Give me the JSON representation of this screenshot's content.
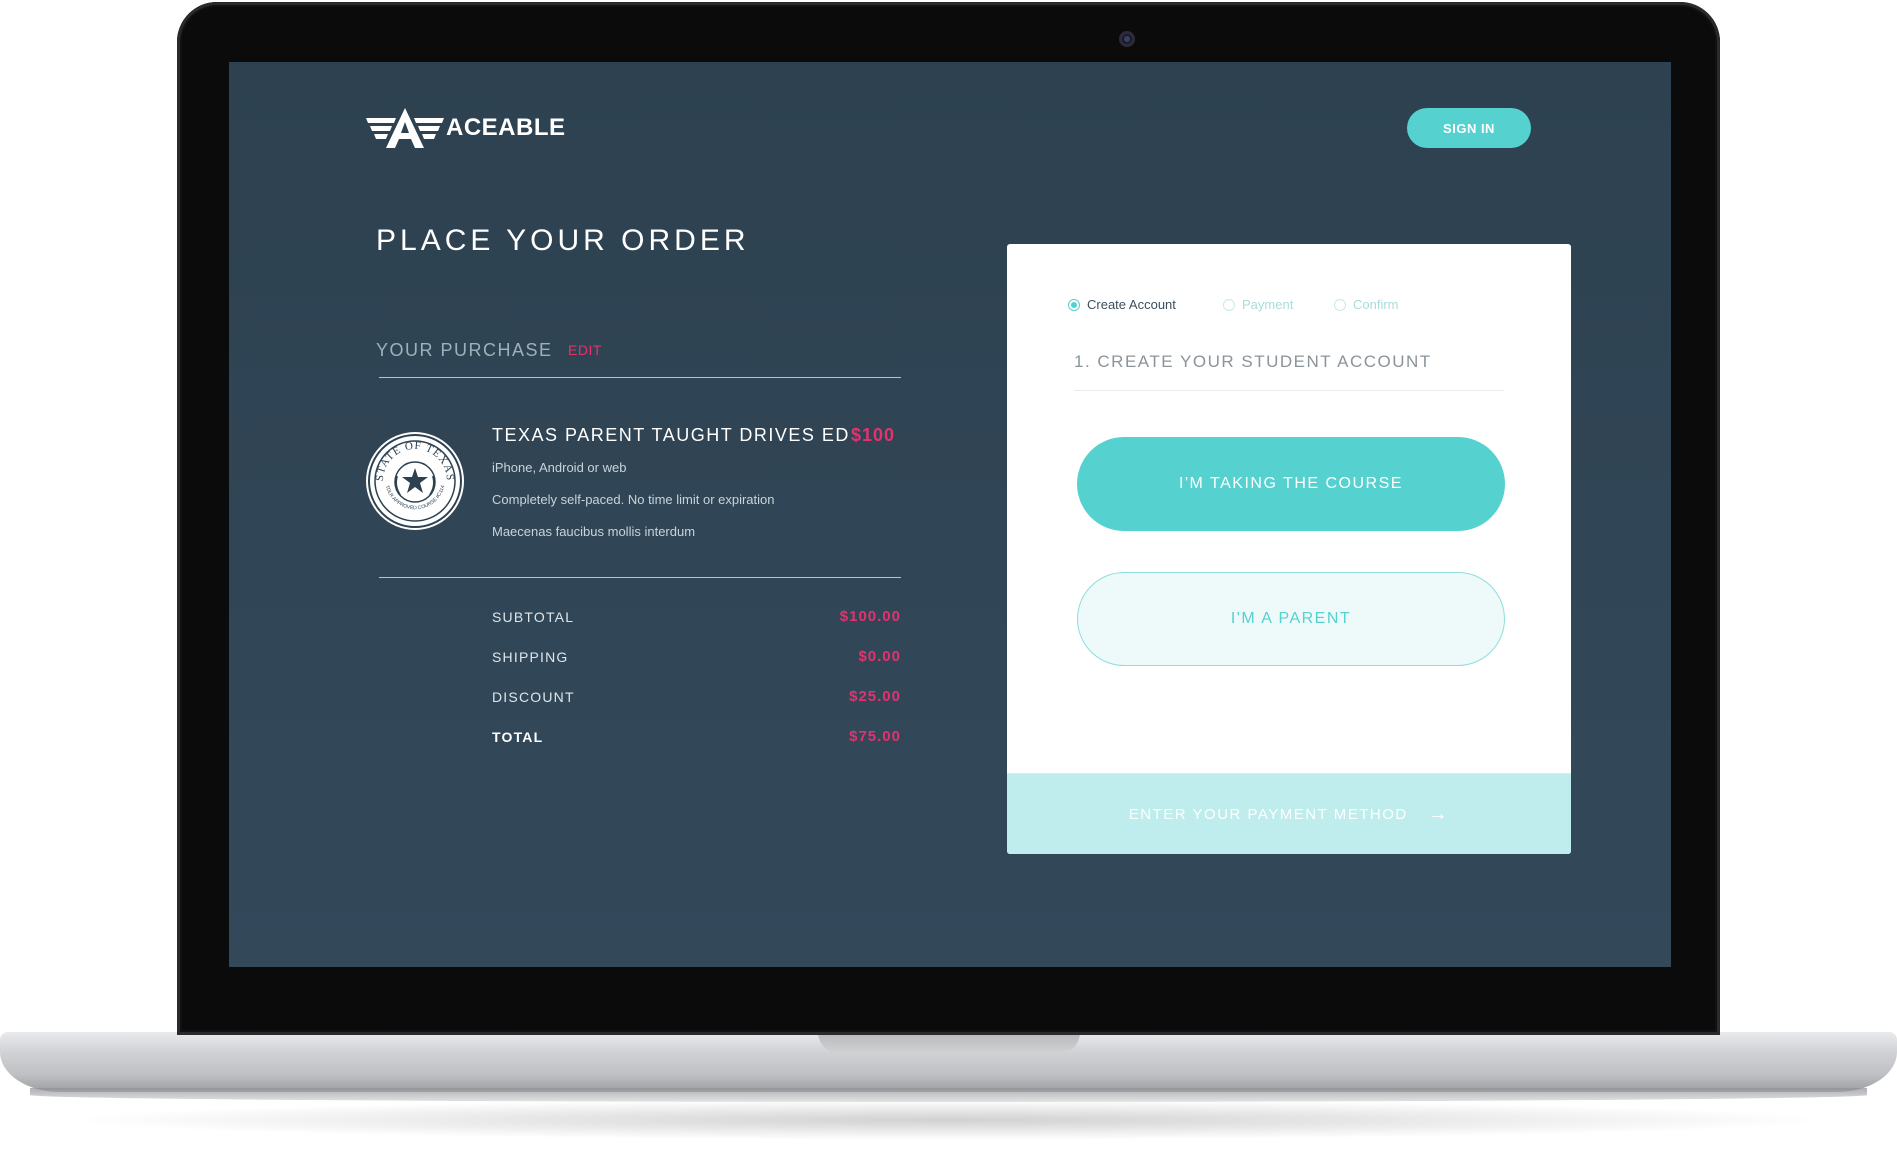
{
  "brand": {
    "name": "ACEABLE",
    "logo_icon": "aceable-wing-logo-icon"
  },
  "header": {
    "signin_label": "SIGN IN"
  },
  "order": {
    "title": "PLACE YOUR ORDER",
    "purchase_heading": "YOUR PURCHASE",
    "edit_label": "EDIT",
    "product": {
      "name": "TEXAS PARENT TAUGHT DRIVES ED",
      "price": "$100",
      "seal_top_text": "STATE OF TEXAS",
      "seal_bottom_text": "TDLR APPROVED COURSE #C114",
      "features": [
        "iPhone, Android or web",
        "Completely self-paced. No time limit or expiration",
        "Maecenas faucibus mollis interdum"
      ]
    },
    "summary": [
      {
        "label": "SUBTOTAL",
        "value": "$100.00"
      },
      {
        "label": "SHIPPING",
        "value": "$0.00"
      },
      {
        "label": "DISCOUNT",
        "value": "$25.00"
      },
      {
        "label": "TOTAL",
        "value": "$75.00"
      }
    ]
  },
  "checkout": {
    "steps": [
      {
        "label": "Create Account",
        "active": true
      },
      {
        "label": "Payment",
        "active": false
      },
      {
        "label": "Confirm",
        "active": false
      }
    ],
    "heading": "1. CREATE YOUR STUDENT ACCOUNT",
    "course_button": "I'M TAKING THE COURSE",
    "parent_button": "I'M A PARENT",
    "footer_label": "ENTER YOUR PAYMENT METHOD",
    "footer_icon": "arrow-right-icon"
  },
  "colors": {
    "accent": "#55d1cf",
    "price": "#e5316f",
    "screen_bg": "#2d4150"
  }
}
